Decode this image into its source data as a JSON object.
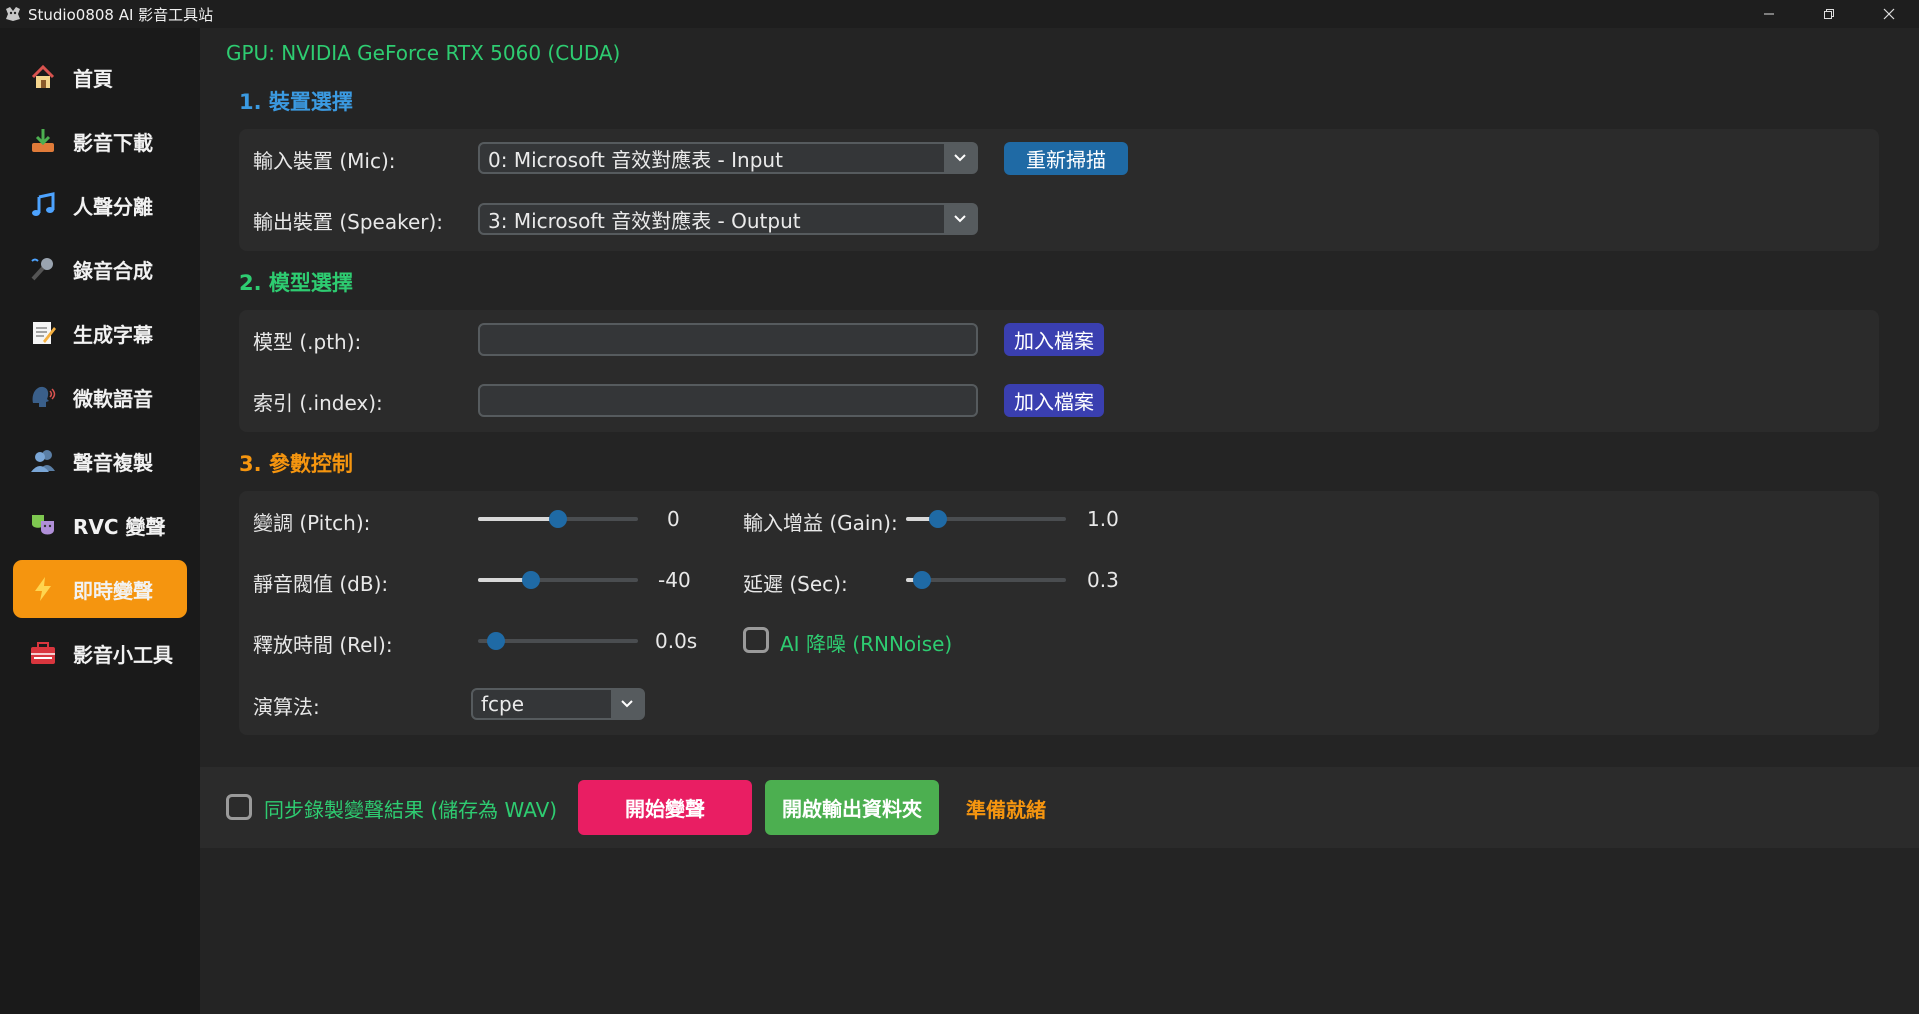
{
  "window": {
    "title": "Studio0808 AI 影音工具站",
    "controls": [
      "minimize-icon",
      "restore-icon",
      "close-icon"
    ]
  },
  "sidebar": {
    "items": [
      {
        "label": "首頁",
        "icon": "home-icon"
      },
      {
        "label": "影音下載",
        "icon": "download-icon"
      },
      {
        "label": "人聲分離",
        "icon": "music-note-icon"
      },
      {
        "label": "錄音合成",
        "icon": "microphone-icon"
      },
      {
        "label": "生成字幕",
        "icon": "memo-icon"
      },
      {
        "label": "微軟語音",
        "icon": "speaking-head-icon"
      },
      {
        "label": "聲音複製",
        "icon": "people-icon"
      },
      {
        "label": "RVC 變聲",
        "icon": "theater-masks-icon"
      },
      {
        "label": "即時變聲",
        "icon": "lightning-icon",
        "active": true
      },
      {
        "label": "影音小工具",
        "icon": "toolbox-icon"
      }
    ],
    "active_color": "#f5950f"
  },
  "gpu_info": "GPU: NVIDIA GeForce RTX 5060 (CUDA)",
  "device_section": {
    "title": "1. 裝置選擇",
    "title_color": "#3b9ae1",
    "input_label": "輸入裝置 (Mic):",
    "input_value": "0: Microsoft 音效對應表 - Input",
    "rescan_button": "重新掃描",
    "output_label": "輸出裝置 (Speaker):",
    "output_value": "3: Microsoft 音效對應表 - Output"
  },
  "model_section": {
    "title": "2. 模型選擇",
    "title_color": "#2ecc71",
    "model_label": "模型 (.pth):",
    "model_value": "",
    "index_label": "索引 (.index):",
    "index_value": "",
    "add_file_button": "加入檔案"
  },
  "params_section": {
    "title": "3. 參數控制",
    "title_color": "#f5950f",
    "pitch": {
      "label": "變調 (Pitch):",
      "value": "0",
      "fraction": 0.5
    },
    "silence": {
      "label": "靜音閥值 (dB):",
      "value": "-40",
      "fraction": 0.33
    },
    "release": {
      "label": "釋放時間 (Rel):",
      "value": "0.0s",
      "fraction": 0.0
    },
    "gain": {
      "label": "輸入增益 (Gain):",
      "value": "1.0",
      "fraction": 0.2
    },
    "delay": {
      "label": "延遲 (Sec):",
      "value": "0.3",
      "fraction": 0.1
    },
    "denoise": {
      "label": "AI 降噪 (RNNoise)",
      "checked": false
    },
    "algorithm": {
      "label": "演算法:",
      "value": "fcpe"
    }
  },
  "bottom": {
    "record_label": "同步錄製變聲結果 (儲存為 WAV)",
    "record_checked": false,
    "start_button": "開始變聲",
    "start_color": "#e91e63",
    "open_folder_button": "開啟輸出資料夾",
    "open_folder_color": "#4caf50",
    "status": "準備就緒",
    "status_color": "#f5950f"
  }
}
